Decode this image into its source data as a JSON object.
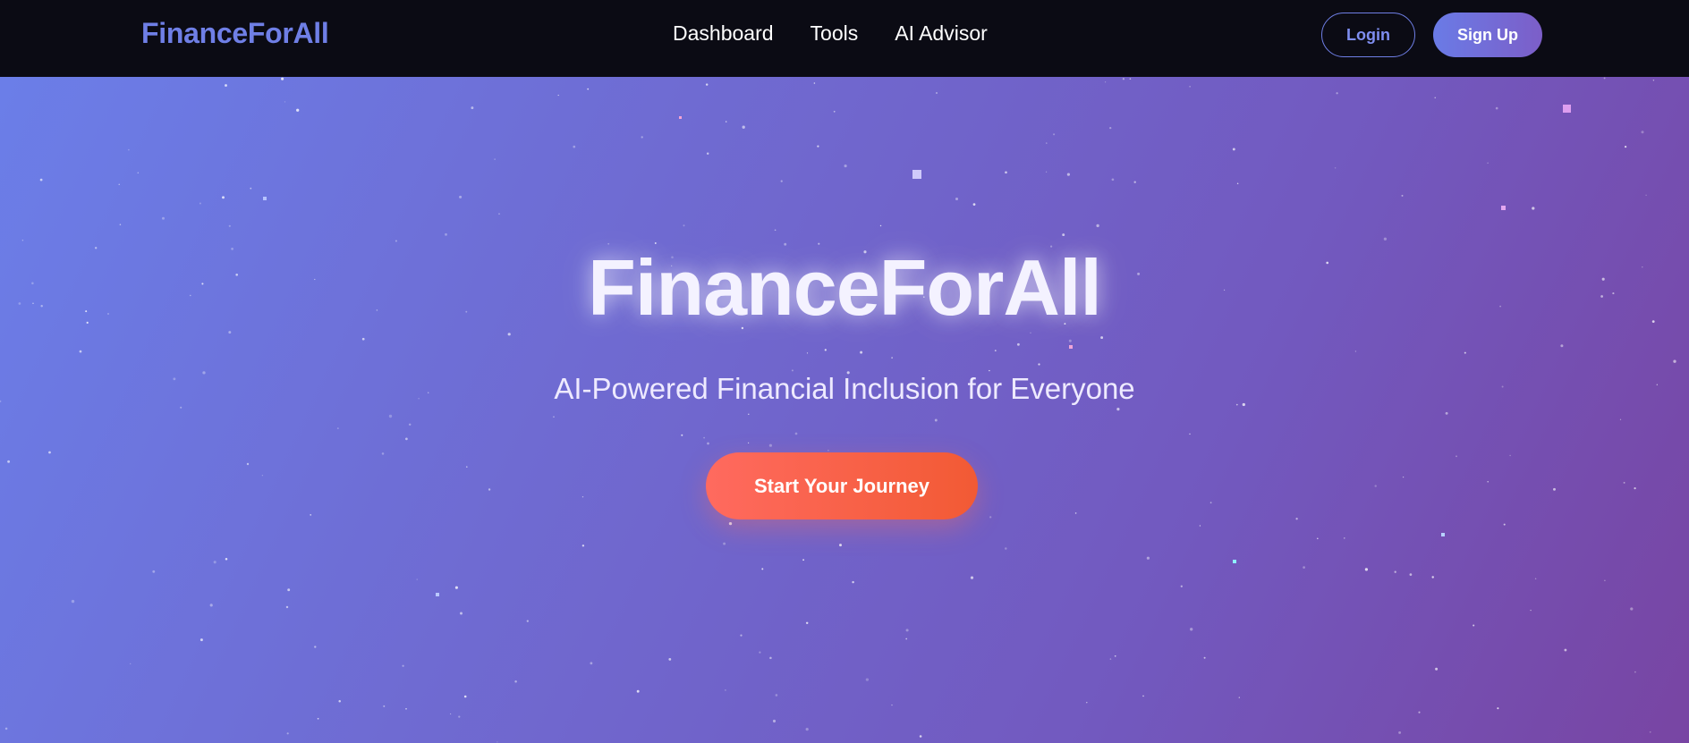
{
  "nav": {
    "brand": "FinanceForAll",
    "links": [
      "Dashboard",
      "Tools",
      "AI Advisor"
    ],
    "login_label": "Login",
    "signup_label": "Sign Up"
  },
  "hero": {
    "title": "FinanceForAll",
    "subtitle": "AI-Powered Financial Inclusion for Everyone",
    "cta_label": "Start Your Journey"
  },
  "colors": {
    "brand": "#6f7fe6",
    "navbar_bg": "#0b0b14",
    "hero_gradient_start": "#6b7ee8",
    "hero_gradient_end": "#7845a3",
    "cta_gradient_start": "#ff6a5f",
    "cta_gradient_end": "#f25a34"
  }
}
